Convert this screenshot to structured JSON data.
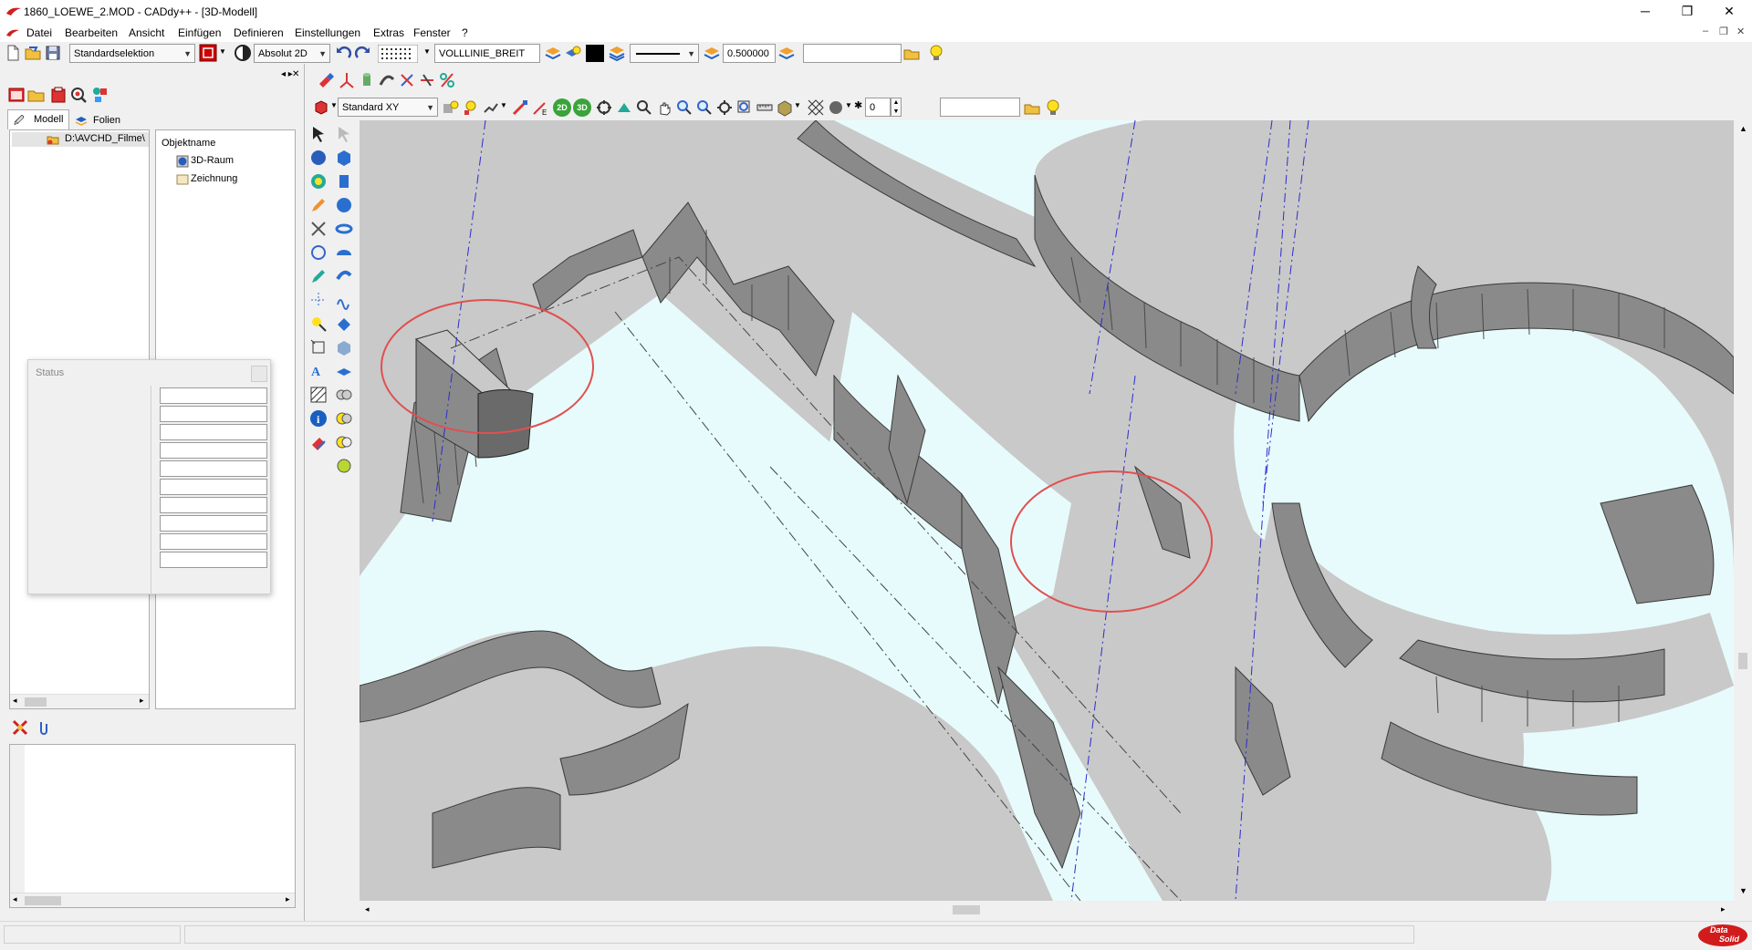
{
  "window": {
    "title": "1860_LOEWE_2.MOD  -  CADdy++ - [3D-Modell]",
    "minimize": "─",
    "maximize": "❐",
    "close": "✕"
  },
  "menu": {
    "items": [
      "Datei",
      "Bearbeiten",
      "Ansicht",
      "Einfügen",
      "Definieren",
      "Einstellungen",
      "Extras",
      "Fenster",
      "?"
    ],
    "mdi_minimize": "–",
    "mdi_restore": "❐",
    "mdi_close": "✕"
  },
  "toolbar1": {
    "selection_mode": "Standardselektion",
    "coord_mode": "Absolut 2D",
    "line_type": "VOLLLINIE_BREIT",
    "line_width": "0.500000",
    "text_field": ""
  },
  "toolbar2": {
    "view": "Standard XY",
    "label_2d": "2D",
    "label_3d": "3D",
    "numeric_value": "0",
    "text_field": ""
  },
  "left_panel": {
    "tab_model": "Modell",
    "tab_layers": "Folien",
    "path": "D:\\AVCHD_Filme\\",
    "object_header": "Objektname",
    "objects": [
      "3D-Raum",
      "Zeichnung"
    ]
  },
  "status_panel": {
    "title": "Status"
  },
  "colors": {
    "accent_red": "#d03030",
    "highlight_circle": "#e05050",
    "viewport_surface": "#c9c9c9",
    "viewport_background": "#e8fbfc",
    "wall_face": "#8a8a8a",
    "construction_line": "#2b2bd0"
  },
  "icons": {
    "logo": "caddy-logo-icon",
    "brand": "datasolid-logo"
  },
  "brand": {
    "logo_text_1": "Data",
    "logo_text_2": "Solid"
  }
}
